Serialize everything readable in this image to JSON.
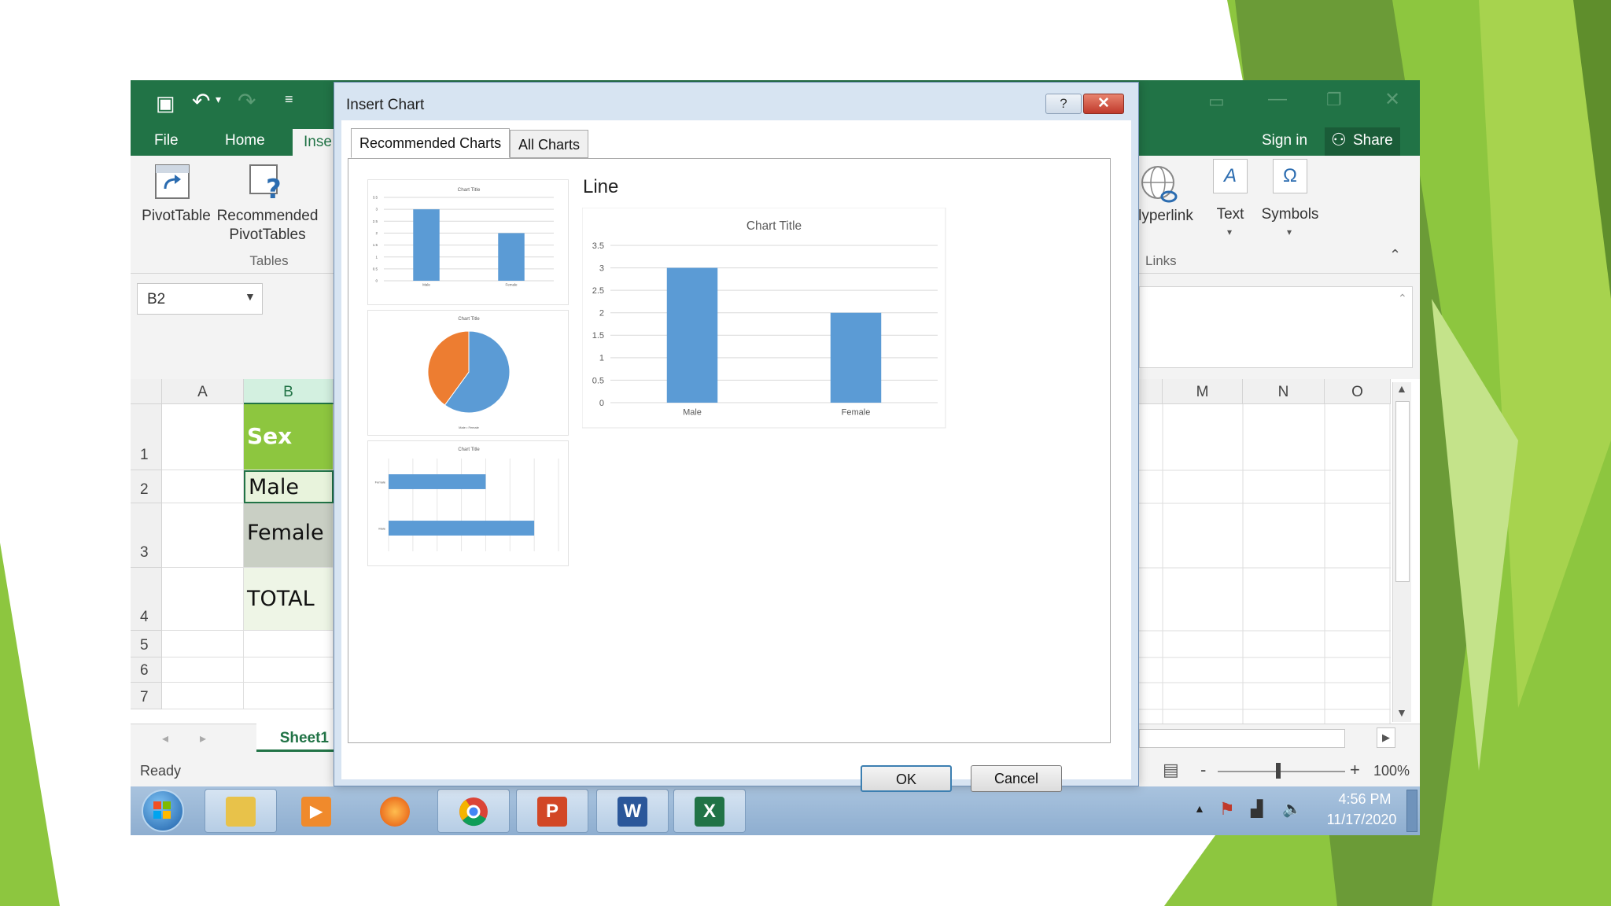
{
  "excel": {
    "tabs": [
      {
        "label": "File"
      },
      {
        "label": "Home"
      },
      {
        "label": "Inse"
      }
    ],
    "sign_in": "Sign in",
    "share": "Share",
    "ribbon": {
      "pivot_table": "PivotTable",
      "recommended_1": "Recommended",
      "recommended_2": "PivotTables",
      "tables_group": "Tables",
      "hyperlink": "lyperlink",
      "text": "Text",
      "symbols": "Symbols",
      "links_group": "Links",
      "omega": "Ω",
      "text_icon": "A"
    },
    "namebox": "B2",
    "columns": [
      "A",
      "B",
      "M",
      "N",
      "O"
    ],
    "rows": [
      "1",
      "2",
      "3",
      "4",
      "5",
      "6",
      "7"
    ],
    "cells": {
      "b1": "Sex",
      "b2": "Male",
      "b3": "Female",
      "b4": "TOTAL"
    },
    "sheet_tab": "Sheet1",
    "status": "Ready",
    "zoom": "100%",
    "zoom_minus": "-",
    "zoom_plus": "+"
  },
  "taskbar": {
    "time": "4:56 PM",
    "date": "11/17/2020",
    "apps": [
      {
        "name": "file-explorer",
        "glyph": ""
      },
      {
        "name": "media-player",
        "glyph": "▶"
      },
      {
        "name": "firefox",
        "glyph": ""
      },
      {
        "name": "chrome",
        "glyph": ""
      },
      {
        "name": "powerpoint",
        "glyph": "P"
      },
      {
        "name": "word",
        "glyph": "W"
      },
      {
        "name": "excel",
        "glyph": "X"
      }
    ]
  },
  "dialog": {
    "title": "Insert Chart",
    "help": "?",
    "close": "✕",
    "tabs": [
      {
        "label": "Recommended Charts"
      },
      {
        "label": "All Charts"
      }
    ],
    "preview_type": "Line",
    "ok": "OK",
    "cancel": "Cancel"
  },
  "chart_data": [
    {
      "type": "bar",
      "title": "Chart Title",
      "categories": [
        "Male",
        "Female"
      ],
      "values": [
        3,
        2
      ],
      "ylim": [
        0,
        3.5
      ],
      "yticks": [
        "0",
        "0.5",
        "1",
        "1.5",
        "2",
        "2.5",
        "3",
        "3.5"
      ],
      "grid": true,
      "color": "#5b9bd5"
    },
    {
      "type": "pie",
      "title": "Chart Title",
      "categories": [
        "Male",
        "Female"
      ],
      "values": [
        3,
        2
      ],
      "colors": [
        "#5b9bd5",
        "#ed7d31"
      ]
    },
    {
      "type": "bar",
      "orientation": "horizontal",
      "title": "Chart Title",
      "categories": [
        "Female",
        "Male"
      ],
      "values": [
        2,
        3
      ],
      "xlim": [
        0,
        3.5
      ],
      "color": "#5b9bd5"
    }
  ],
  "colors": {
    "excel_green": "#217346",
    "sex_header": "#8dc63f",
    "bar_blue": "#5b9bd5",
    "pie_orange": "#ed7d31"
  }
}
